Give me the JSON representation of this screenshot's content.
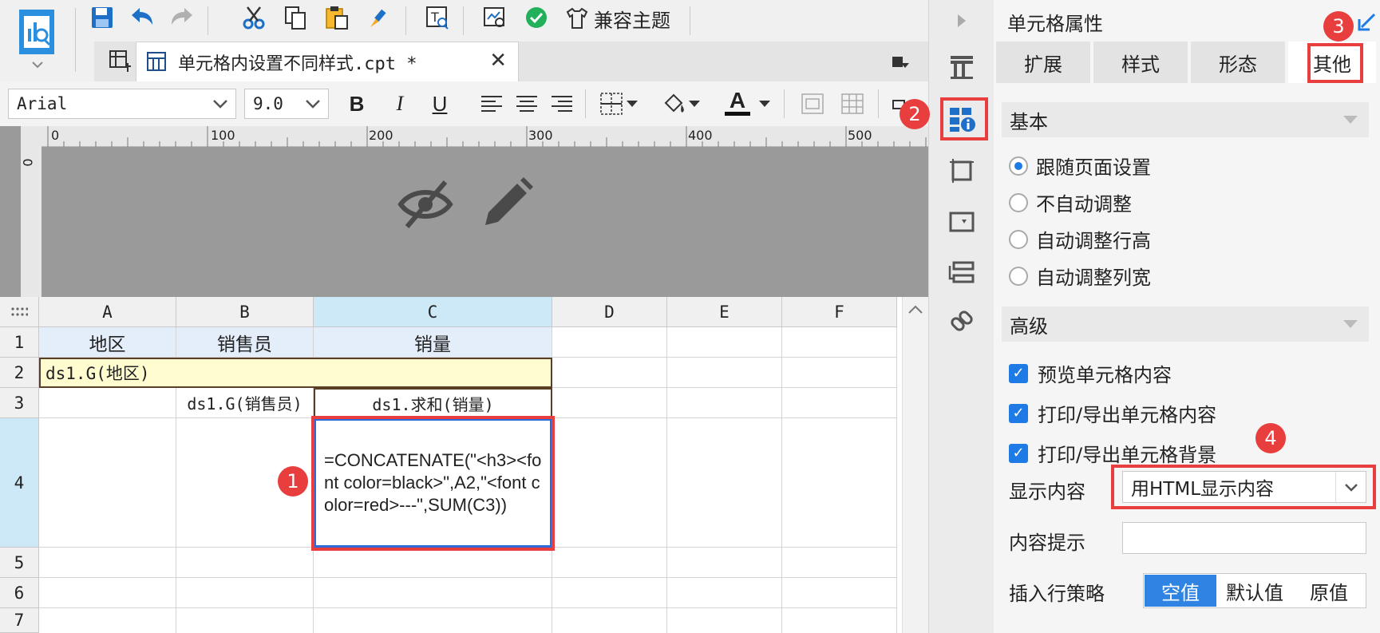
{
  "toolbar": {
    "theme_label": "兼容主题"
  },
  "tab": {
    "title": "单元格内设置不同样式.cpt *"
  },
  "format": {
    "font": "Arial",
    "size": "9.0",
    "bold": "B",
    "italic": "I",
    "underline": "U",
    "font_color_glyph": "A"
  },
  "ruler": {
    "ticks": [
      "0",
      "100",
      "200",
      "300",
      "400",
      "500"
    ],
    "v0": "0"
  },
  "grid": {
    "columns": [
      "A",
      "B",
      "C",
      "D",
      "E",
      "F"
    ],
    "rows": [
      "1",
      "2",
      "3",
      "4",
      "5",
      "6",
      "7"
    ],
    "r1": {
      "a": "地区",
      "b": "销售员",
      "c": "销量"
    },
    "r2": {
      "a": "ds1.G(地区)"
    },
    "r3": {
      "b": "ds1.G(销售员)",
      "c": "ds1.求和(销量)"
    },
    "r4": {
      "c": "=CONCATENATE(\"<h3><font color=black>\",A2,\"<font color=red>---\",SUM(C3))"
    }
  },
  "panel": {
    "title": "单元格属性",
    "tabs": [
      "扩展",
      "样式",
      "形态",
      "其他"
    ],
    "basic": {
      "title": "基本",
      "options": [
        "跟随页面设置",
        "不自动调整",
        "自动调整行高",
        "自动调整列宽"
      ]
    },
    "advanced": {
      "title": "高级",
      "checks": [
        "预览单元格内容",
        "打印/导出单元格内容",
        "打印/导出单元格背景"
      ]
    },
    "display_label": "显示内容",
    "display_value": "用HTML显示内容",
    "tooltip_label": "内容提示",
    "insert_label": "插入行策略",
    "insert_options": [
      "空值",
      "默认值",
      "原值"
    ]
  },
  "badges": [
    "1",
    "2",
    "3",
    "4"
  ],
  "colors": {
    "accent": "#1e7be5",
    "highlight": "#e83e3e",
    "selected_col": "#cde9f7",
    "merged_bg": "#fffccf"
  }
}
